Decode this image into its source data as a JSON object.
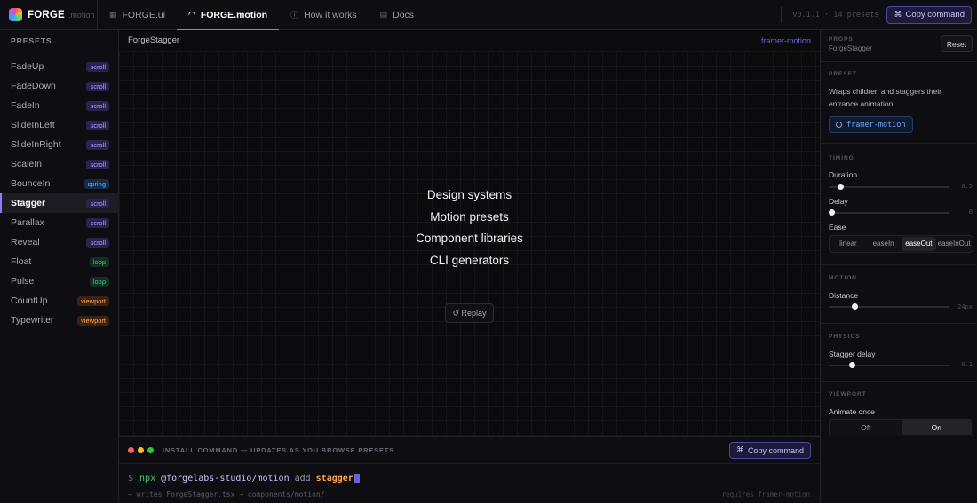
{
  "brand": {
    "name": "FORGE",
    "sub": ".motion"
  },
  "nav": [
    {
      "label": "FORGE.ui",
      "icon": "grid-icon"
    },
    {
      "label": "FORGE.motion",
      "icon": "motion-icon",
      "active": true
    },
    {
      "label": "How it works",
      "icon": "info-icon"
    },
    {
      "label": "Docs",
      "icon": "doc-icon"
    }
  ],
  "topbar": {
    "version": "v0.1.1 · 14 presets",
    "copy_label": "Copy command",
    "copy_icon": "⌘"
  },
  "sidebar": {
    "title": "PRESETS",
    "items": [
      {
        "label": "FadeUp",
        "badge": "scroll"
      },
      {
        "label": "FadeDown",
        "badge": "scroll"
      },
      {
        "label": "FadeIn",
        "badge": "scroll"
      },
      {
        "label": "SlideInLeft",
        "badge": "scroll"
      },
      {
        "label": "SlideInRight",
        "badge": "scroll"
      },
      {
        "label": "ScaleIn",
        "badge": "scroll"
      },
      {
        "label": "BounceIn",
        "badge": "spring"
      },
      {
        "label": "Stagger",
        "badge": "scroll",
        "active": true
      },
      {
        "label": "Parallax",
        "badge": "scroll"
      },
      {
        "label": "Reveal",
        "badge": "scroll"
      },
      {
        "label": "Float",
        "badge": "loop"
      },
      {
        "label": "Pulse",
        "badge": "loop"
      },
      {
        "label": "CountUp",
        "badge": "viewport"
      },
      {
        "label": "Typewriter",
        "badge": "viewport"
      }
    ]
  },
  "main": {
    "title": "ForgeStagger",
    "lib": "framer-motion",
    "stagger_items": [
      "Design systems",
      "Motion presets",
      "Component libraries",
      "CLI generators"
    ],
    "replay_label": "↺ Replay"
  },
  "terminal": {
    "label": "INSTALL COMMAND — UPDATES AS YOU BROWSE PRESETS",
    "copy_label": "Copy command",
    "copy_icon": "⌘",
    "prompt": "$",
    "cmd_npx": "npx",
    "cmd_pkg": "@forgelabs-studio/motion",
    "cmd_add": "add",
    "cmd_arg": "stagger",
    "writes": "→ writes ForgeStagger.tsx → components/motion/",
    "requires": "requires framer-motion",
    "dot_colors": [
      "#ff5f57",
      "#febc2e",
      "#28c840"
    ]
  },
  "panel": {
    "props_caption": "PROPS",
    "props_sub": "ForgeStagger",
    "reset_label": "Reset",
    "preset_caption": "PRESET",
    "description": "Wraps children and staggers their entrance animation.",
    "lib_chip": "framer-motion",
    "timing_caption": "TIMING",
    "duration_label": "Duration",
    "duration_value": "0.5",
    "duration_fraction": 0.08,
    "delay_label": "Delay",
    "delay_value": "0",
    "delay_fraction": 0.0,
    "ease_label": "Ease",
    "ease_options": [
      "linear",
      "easeIn",
      "easeOut",
      "easeInOut"
    ],
    "ease_selected": "easeOut",
    "motion_caption": "MOTION",
    "distance_label": "Distance",
    "distance_value": "24px",
    "distance_fraction": 0.2,
    "physics_caption": "PHYSICS",
    "stagger_label": "Stagger delay",
    "stagger_value": "0.1",
    "stagger_fraction": 0.18,
    "viewport_caption": "VIEWPORT",
    "animate_once_label": "Animate once",
    "toggle_options": [
      "Off",
      "On"
    ],
    "toggle_selected": "On"
  }
}
